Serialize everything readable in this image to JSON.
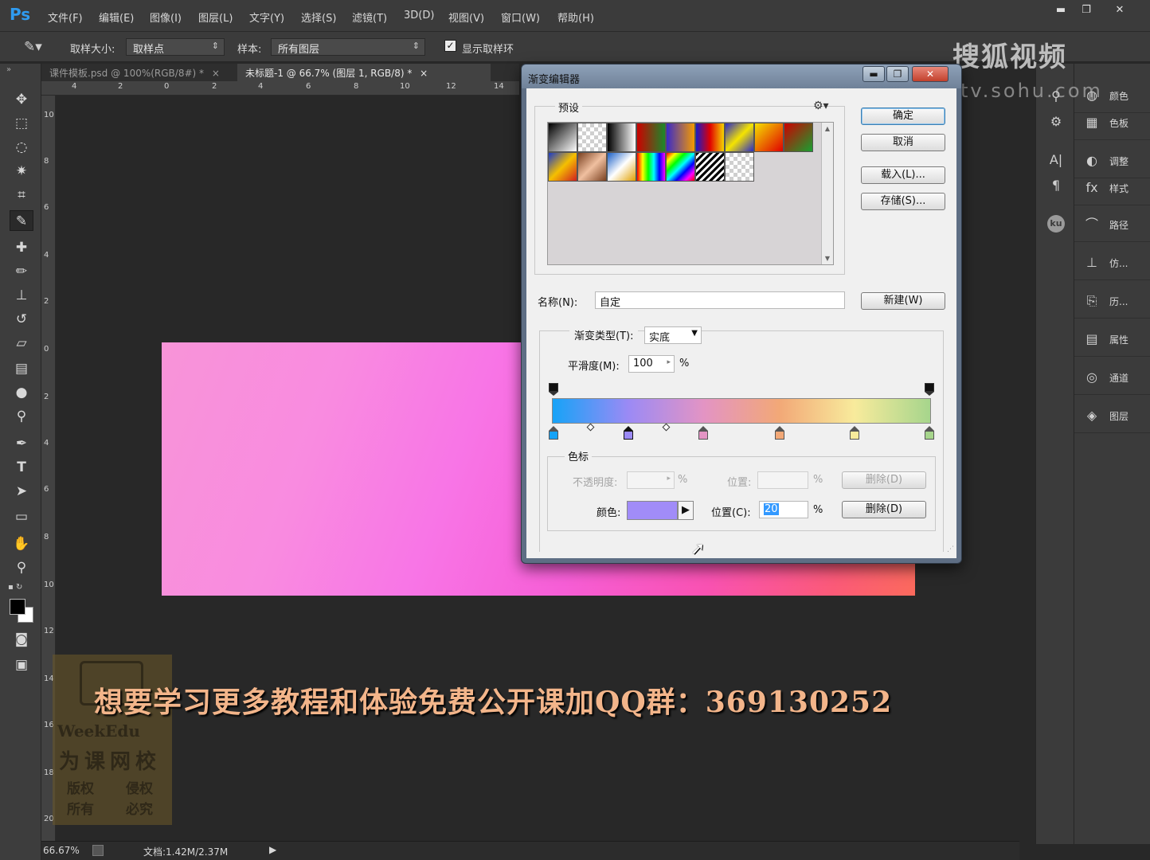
{
  "app": {
    "logo": "Ps"
  },
  "menu": [
    "文件(F)",
    "编辑(E)",
    "图像(I)",
    "图层(L)",
    "文字(Y)",
    "选择(S)",
    "滤镜(T)",
    "3D(D)",
    "视图(V)",
    "窗口(W)",
    "帮助(H)"
  ],
  "window_controls": {
    "minimize": "▬",
    "maximize": "❐",
    "close": "✕"
  },
  "options": {
    "sample_size_label": "取样大小:",
    "sample_size_value": "取样点",
    "sample_label": "样本:",
    "sample_value": "所有图层",
    "show_ring_label": "显示取样环",
    "show_ring_checked": true
  },
  "tabs": [
    {
      "label": "课件模板.psd @ 100%(RGB/8#) *",
      "close": "×"
    },
    {
      "label": "未标题-1 @ 66.7% (图层 1, RGB/8) *",
      "close": "×"
    }
  ],
  "ruler_top": [
    "4",
    "2",
    "0",
    "2",
    "4",
    "6",
    "8",
    "10",
    "12",
    "14"
  ],
  "ruler_left": [
    "10",
    "8",
    "6",
    "4",
    "2",
    "0",
    "2",
    "4",
    "6",
    "8",
    "10",
    "12",
    "14",
    "16",
    "18",
    "20"
  ],
  "status": {
    "zoom": "66.67%",
    "doc": "文档:1.42M/2.37M"
  },
  "watermark": {
    "brand": "搜狐视频",
    "url": "tv.sohu.com"
  },
  "panels": [
    {
      "label": "颜色",
      "icon": "color-icon"
    },
    {
      "label": "色板",
      "icon": "swatches-icon"
    },
    {
      "label": "调整",
      "icon": "adjustments-icon"
    },
    {
      "label": "样式",
      "icon": "styles-icon"
    },
    {
      "label": "路径",
      "icon": "paths-icon"
    },
    {
      "label": "仿...",
      "icon": "clone-source-icon"
    },
    {
      "label": "历...",
      "icon": "history-icon"
    },
    {
      "label": "属性",
      "icon": "properties-icon"
    },
    {
      "label": "通道",
      "icon": "channels-icon"
    },
    {
      "label": "图层",
      "icon": "layers-icon"
    }
  ],
  "dialog": {
    "title": "渐变编辑器",
    "presets_legend": "预设",
    "buttons": {
      "ok": "确定",
      "cancel": "取消",
      "load": "载入(L)...",
      "save": "存储(S)...",
      "new": "新建(W)"
    },
    "name_label": "名称(N):",
    "name_value": "自定",
    "gradient_type_label": "渐变类型(T):",
    "gradient_type_value": "实底",
    "smoothness_label": "平滑度(M):",
    "smoothness_value": "100",
    "percent": "%",
    "color_stops_legend": "色标",
    "opacity_label": "不透明度:",
    "opacity_position_label": "位置:",
    "opacity_delete": "删除(D)",
    "color_label": "颜色:",
    "color_value": "#a18cf8",
    "color_position_label": "位置(C):",
    "color_position_value": "20",
    "color_delete": "删除(D)",
    "gradient_stops": [
      "#16a3f7",
      "#9b8af5",
      "#e394c4",
      "#f2a877",
      "#f8eb9c",
      "#a6d58c"
    ],
    "preset_swatches": [
      "linear-gradient(135deg,#000,#fff)",
      "checker",
      "linear-gradient(90deg,#000,#fff)",
      "linear-gradient(90deg,#c00,#1a8a2a)",
      "linear-gradient(90deg,#3a2ac8,#f59a00)",
      "linear-gradient(90deg,#1a1ac8,#e10000,#f5d400)",
      "linear-gradient(135deg,#2a2ac8,#f5e400,#2a2ac8)",
      "linear-gradient(135deg,#f5e000,#e00000)",
      "linear-gradient(135deg,#c00,#18a030)",
      "linear-gradient(135deg,#1a3ac8,#f5c000,#d02020)",
      "linear-gradient(135deg,#7a4020,#f0c0a0,#7a4020)",
      "linear-gradient(135deg,#1a60c8,#fff,#e0a000)",
      "linear-gradient(90deg,#f00,#ff0,#0f0,#0ff,#00f,#f0f)",
      "linear-gradient(135deg,#f00,#ff0,#0f0,#0ff,#00f,#f0f,#f00)",
      "repeating-linear-gradient(135deg,#000 0 3px,#fff 3px 6px)",
      "checker"
    ]
  },
  "subtitle": "想要学习更多教程和体验免费公开课加QQ群：369130252",
  "weekedu": {
    "line1": "WeekEdu",
    "line2": "为课网校",
    "line3a": "版权",
    "line3b": "侵权",
    "line4a": "所有",
    "line4b": "必究"
  }
}
